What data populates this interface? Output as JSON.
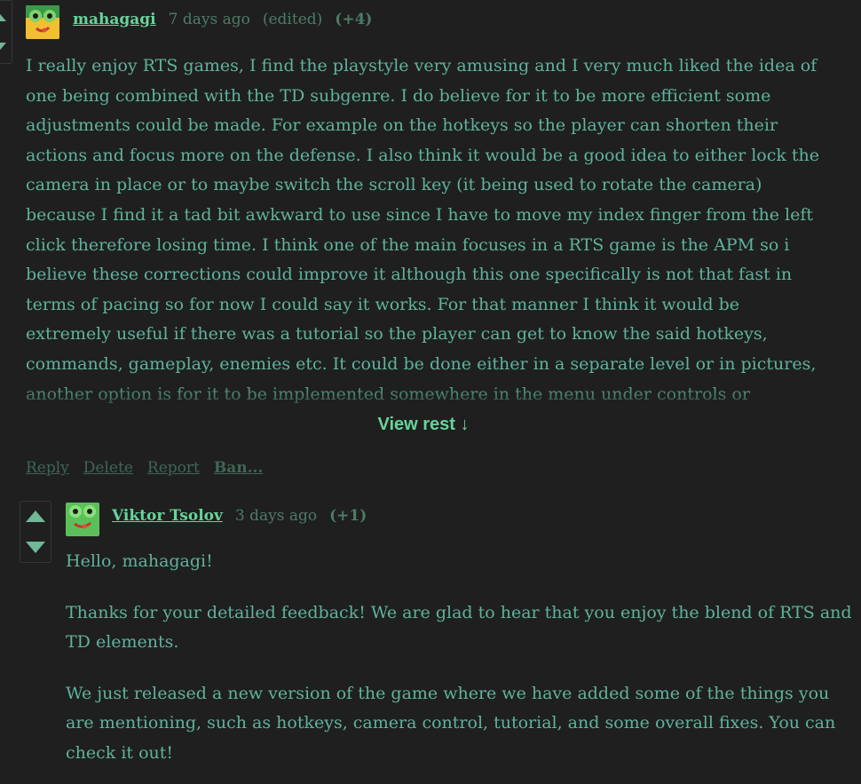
{
  "comment": {
    "author": "mahagagi",
    "time": "7 days ago",
    "edited": "(edited)",
    "score": "(+4)",
    "body": "I really enjoy RTS games, I find the playstyle very amusing and I very much liked the idea of one being combined with the TD subgenre. I do believe for it to be more efficient some adjustments could be made. For example on the hotkeys so the player can shorten their actions and focus more on the defense. I also think it would be a good idea to either lock the camera in place or to maybe switch the scroll key (it being used to rotate the camera) because I find it a tad bit awkward to use since I have to move my index finger from the left click therefore losing time. I think one of the main focuses in a RTS game is the APM so i believe these corrections could improve it although this one specifically is not that fast in terms of pacing so for now I could say it works. For that manner I think it would be extremely useful if there was a tutorial so the player can get to know the said hotkeys, commands, gameplay, enemies etc. It could be done either in a separate level or in pictures, another option is for it to be implemented somewhere in the menu under controls or something along those lines although that would work only for",
    "view_rest": "View rest ↓",
    "actions": {
      "reply": "Reply",
      "delete": "Delete",
      "report": "Report",
      "ban": "Ban..."
    }
  },
  "reply": {
    "author": "Viktor Tsolov",
    "time": "3 days ago",
    "score": "(+1)",
    "paragraphs": [
      "Hello, mahagagi!",
      "Thanks for your detailed feedback! We are glad to hear that you enjoy the blend of RTS and TD elements.",
      "We just released a new version of the game where we have added some of the things you are mentioning, such as hotkeys, camera control, tutorial, and some overall fixes. You can check it out!"
    ]
  },
  "icons": {
    "upvote": "upvote-arrow-icon",
    "downvote": "downvote-arrow-icon",
    "avatar": "frog-avatar"
  },
  "colors": {
    "background": "#1f1f1f",
    "text": "#5fb39b",
    "author_link": "#67d49b",
    "muted": "#4d7b68",
    "action_link": "#3f6656"
  }
}
